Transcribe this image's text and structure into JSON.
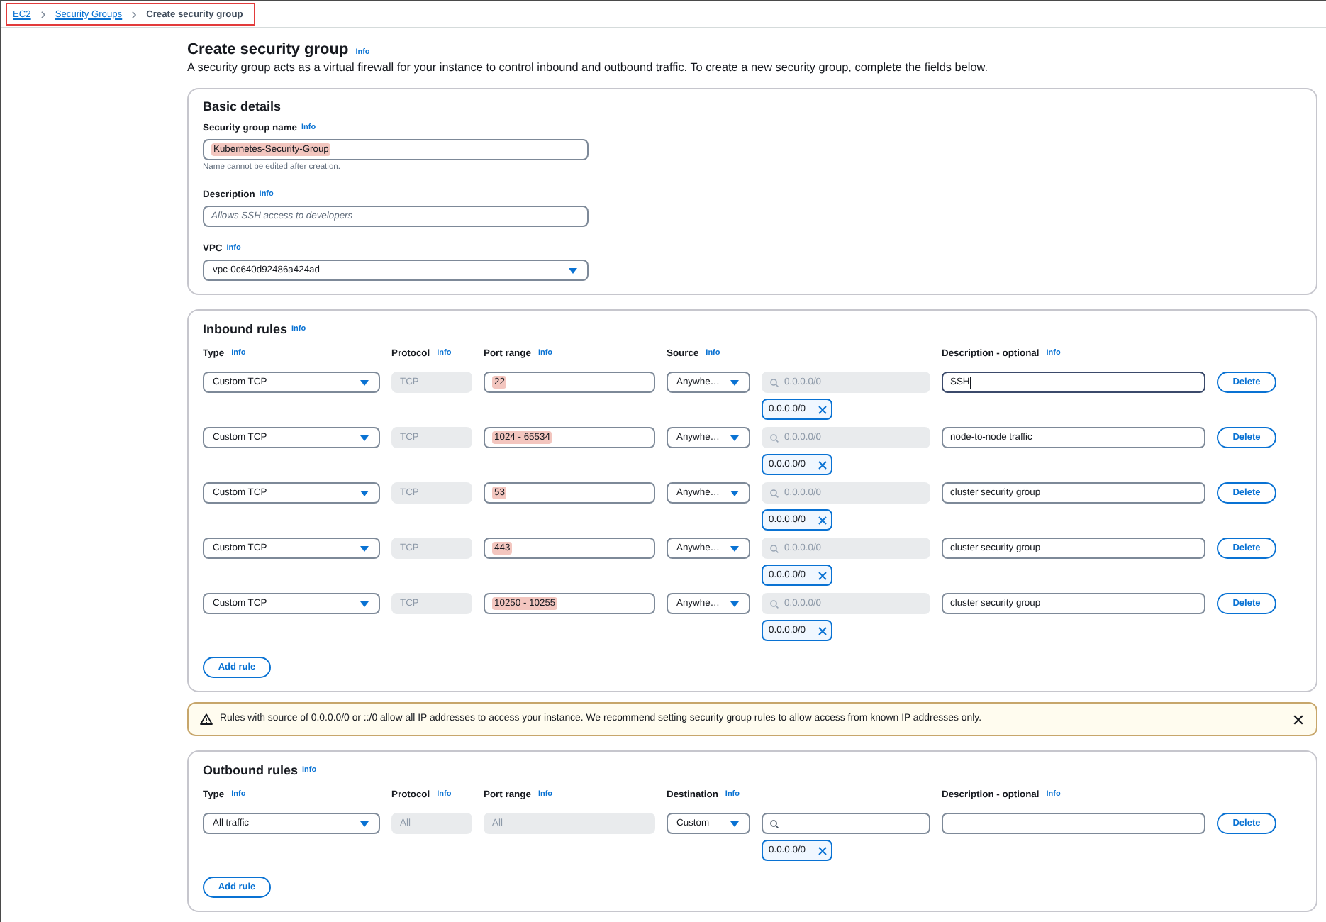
{
  "breadcrumb": {
    "highlighted": true,
    "items": [
      {
        "label": "EC2",
        "link": true
      },
      {
        "label": "Security Groups",
        "link": true
      },
      {
        "label": "Create security group",
        "link": false
      }
    ]
  },
  "header": {
    "title": "Create security group",
    "info": "Info",
    "description": "A security group acts as a virtual firewall for your instance to control inbound and outbound traffic. To create a new security group, complete the fields below."
  },
  "basic_details": {
    "title": "Basic details",
    "fields": [
      {
        "kind": "text",
        "label": "Security group name",
        "info": "Info",
        "value": "Kubernetes-Security-Group",
        "highlighted": true,
        "hint": "Name cannot be edited after creation."
      },
      {
        "kind": "text",
        "label": "Description",
        "info": "Info",
        "placeholder": "Allows SSH access to developers",
        "highlighted": false
      },
      {
        "kind": "select",
        "label": "VPC",
        "info": "Info",
        "value": "vpc-0c640d92486a424ad"
      }
    ]
  },
  "inbound_rules": {
    "title": "Inbound rules",
    "info": "Info",
    "columns": [
      {
        "label": "Type",
        "info": "Info"
      },
      {
        "label": "Protocol",
        "info": "Info"
      },
      {
        "label": "Port range",
        "info": "Info"
      },
      {
        "label": "Source",
        "info": "Info"
      },
      {
        "label": "Description - optional",
        "info": "Info"
      }
    ],
    "rules": [
      {
        "type": "Custom TCP",
        "protocol": {
          "value": "TCP",
          "disabled": true
        },
        "port_range": {
          "value": "22",
          "disabled": false,
          "highlighted": true
        },
        "source": "Anywhe…",
        "search": {
          "placeholder": "0.0.0.0/0",
          "disabled": true
        },
        "tokens": [
          "0.0.0.0/0"
        ],
        "description": {
          "value": "SSH",
          "focused": true
        },
        "delete": "Delete"
      },
      {
        "type": "Custom TCP",
        "protocol": {
          "value": "TCP",
          "disabled": true
        },
        "port_range": {
          "value": "1024 - 65534",
          "disabled": false,
          "highlighted": true
        },
        "source": "Anywhe…",
        "search": {
          "placeholder": "0.0.0.0/0",
          "disabled": true
        },
        "tokens": [
          "0.0.0.0/0"
        ],
        "description": {
          "value": "node-to-node traffic",
          "focused": false
        },
        "delete": "Delete"
      },
      {
        "type": "Custom TCP",
        "protocol": {
          "value": "TCP",
          "disabled": true
        },
        "port_range": {
          "value": "53",
          "disabled": false,
          "highlighted": true
        },
        "source": "Anywhe…",
        "search": {
          "placeholder": "0.0.0.0/0",
          "disabled": true
        },
        "tokens": [
          "0.0.0.0/0"
        ],
        "description": {
          "value": "cluster security group",
          "focused": false
        },
        "delete": "Delete"
      },
      {
        "type": "Custom TCP",
        "protocol": {
          "value": "TCP",
          "disabled": true
        },
        "port_range": {
          "value": "443",
          "disabled": false,
          "highlighted": true
        },
        "source": "Anywhe…",
        "search": {
          "placeholder": "0.0.0.0/0",
          "disabled": true
        },
        "tokens": [
          "0.0.0.0/0"
        ],
        "description": {
          "value": "cluster security group",
          "focused": false
        },
        "delete": "Delete"
      },
      {
        "type": "Custom TCP",
        "protocol": {
          "value": "TCP",
          "disabled": true
        },
        "port_range": {
          "value": "10250 - 10255",
          "disabled": false,
          "highlighted": true
        },
        "source": "Anywhe…",
        "search": {
          "placeholder": "0.0.0.0/0",
          "disabled": true
        },
        "tokens": [
          "0.0.0.0/0"
        ],
        "description": {
          "value": "cluster security group",
          "focused": false
        },
        "delete": "Delete"
      }
    ],
    "add_rule": "Add rule"
  },
  "warning": {
    "message": "Rules with source of 0.0.0.0/0 or ::/0 allow all IP addresses to access your instance. We recommend setting security group rules to allow access from known IP addresses only."
  },
  "outbound_rules": {
    "title": "Outbound rules",
    "info": "Info",
    "columns": [
      {
        "label": "Type",
        "info": "Info"
      },
      {
        "label": "Protocol",
        "info": "Info"
      },
      {
        "label": "Port range",
        "info": "Info"
      },
      {
        "label": "Destination",
        "info": "Info"
      },
      {
        "label": "Description - optional",
        "info": "Info"
      }
    ],
    "rules": [
      {
        "type": "All traffic",
        "protocol": {
          "value": "All",
          "disabled": true
        },
        "port_range": {
          "value": "All",
          "disabled": true,
          "highlighted": false
        },
        "destination": "Custom",
        "search": {
          "disabled": false
        },
        "tokens": [
          "0.0.0.0/0"
        ],
        "description": {
          "focused": false
        },
        "delete": "Delete"
      }
    ],
    "add_rule": "Add rule"
  }
}
